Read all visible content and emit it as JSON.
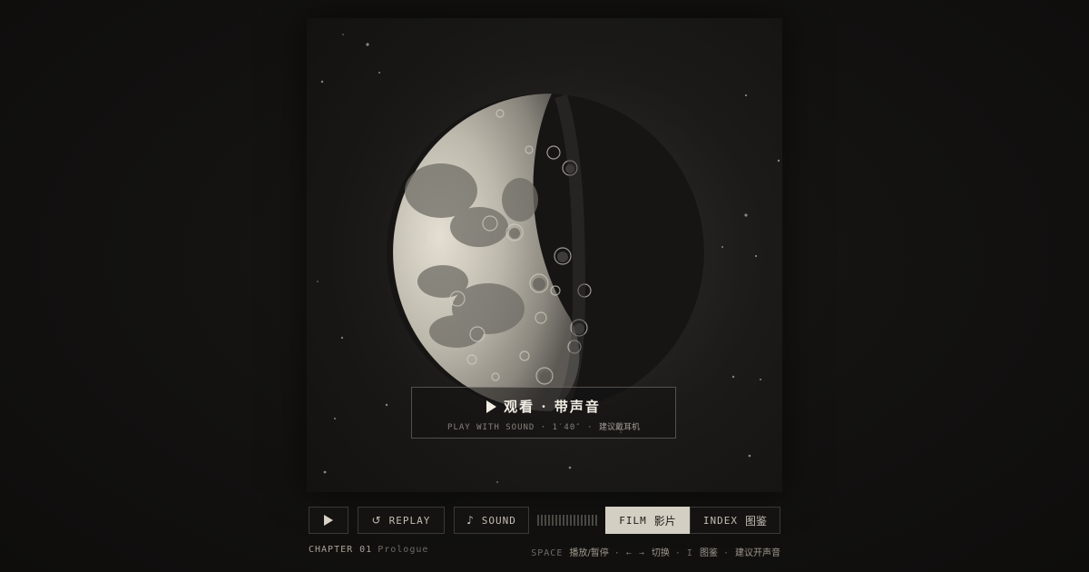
{
  "overlay": {
    "title": "观看 · 带声音",
    "subtitle_en": "PLAY WITH SOUND · 1′40″ ·",
    "subtitle_cn": "建议戴耳机"
  },
  "controls": {
    "replay_label": "REPLAY",
    "sound_label": "SOUND",
    "film_tab_en": "FILM",
    "film_tab_cn": "影片",
    "index_tab_en": "INDEX",
    "index_tab_cn": "图鉴",
    "active_tab": "FILM"
  },
  "footer": {
    "chapter_label": "CHAPTER 01",
    "chapter_title": "Prologue",
    "hint_space_key": "SPACE",
    "hint_space_text": "播放/暂停",
    "hint_arrows_key": "← →",
    "hint_arrows_text": "切换",
    "hint_i_key": "I",
    "hint_i_text": "图鉴",
    "hint_sound_text": "建议开声音"
  },
  "icons": {
    "play": "play-icon",
    "replay": "replay-icon",
    "sound": "music-note-icon",
    "moon": "moon-image"
  },
  "colors": {
    "background": "#121110",
    "accent_tab": "#d4cfc3",
    "text": "#bdb7aa"
  }
}
